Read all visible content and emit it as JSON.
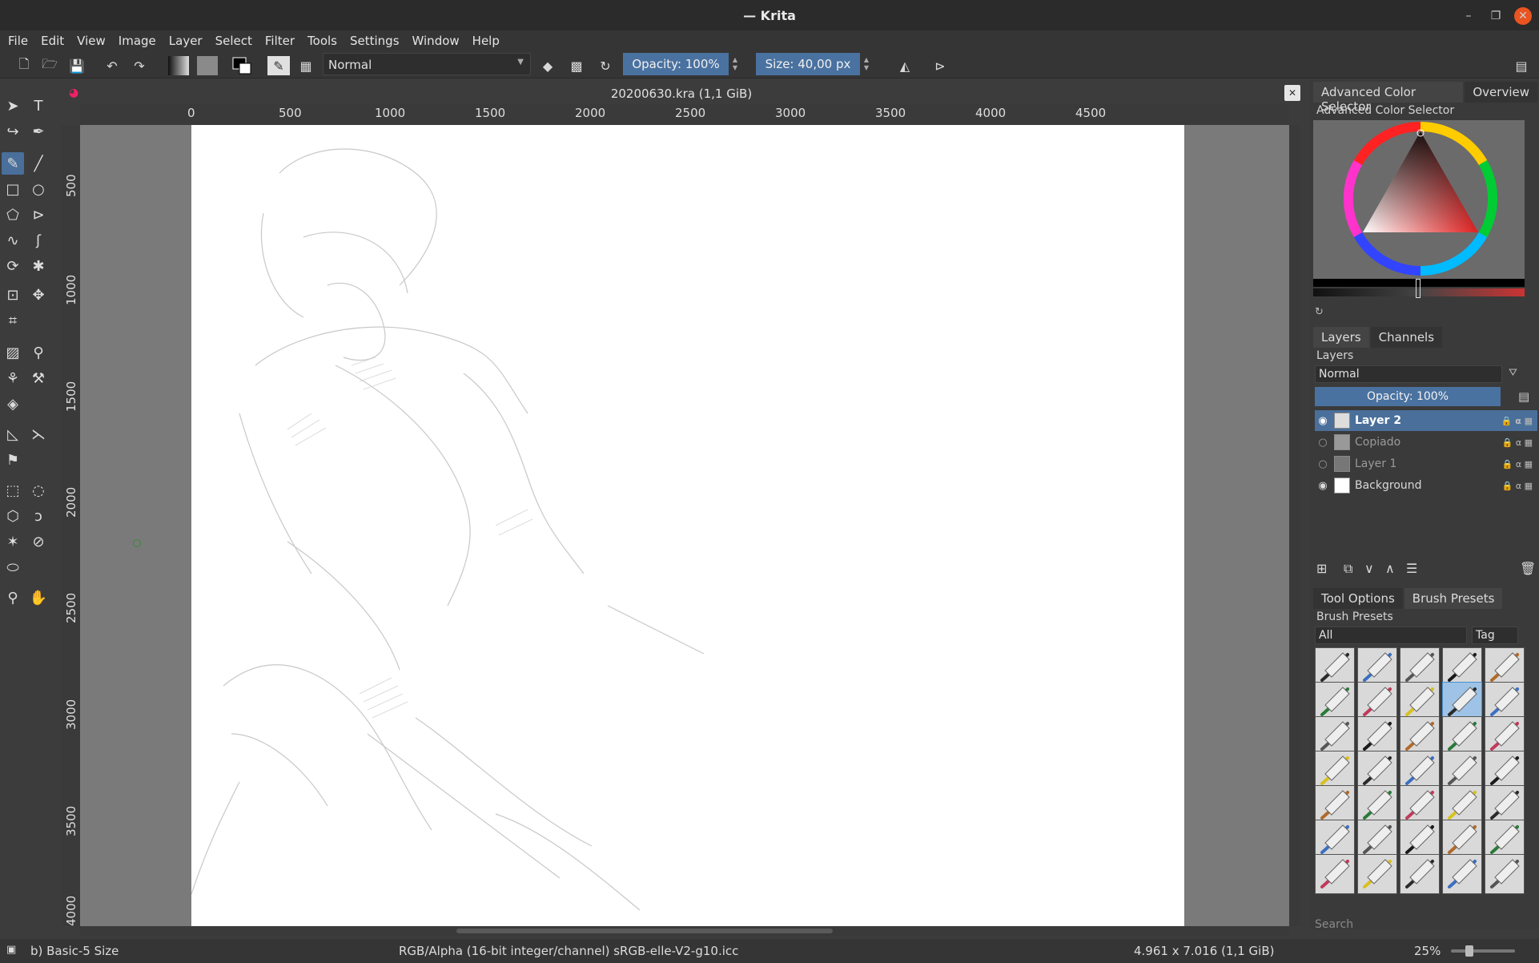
{
  "window": {
    "title": "— Krita"
  },
  "menu": [
    "File",
    "Edit",
    "View",
    "Image",
    "Layer",
    "Select",
    "Filter",
    "Tools",
    "Settings",
    "Window",
    "Help"
  ],
  "toolbar": {
    "blend_mode": "Normal",
    "opacity_label": "Opacity: 100%",
    "size_label": "Size: 40,00 px"
  },
  "document": {
    "title": "20200630.kra (1,1 GiB)",
    "ruler_h": [
      "0",
      "500",
      "1000",
      "1500",
      "2000",
      "2500",
      "3000",
      "3500",
      "4000",
      "4500"
    ],
    "ruler_v": [
      "500",
      "1000",
      "1500",
      "2000",
      "2500",
      "3000",
      "3500",
      "4000"
    ]
  },
  "dock": {
    "color_tabs": [
      "Advanced Color Selector",
      "Overview"
    ],
    "color_panel_title": "Advanced Color Selector",
    "layer_tabs": [
      "Layers",
      "Channels"
    ],
    "layers_title": "Layers",
    "layer_mode": "Normal",
    "layer_opacity": "Opacity:  100%",
    "layers": [
      {
        "name": "Layer 2",
        "visible": true,
        "active": true
      },
      {
        "name": "Copiado",
        "visible": false,
        "active": false
      },
      {
        "name": "Layer 1",
        "visible": false,
        "active": false
      },
      {
        "name": "Background",
        "visible": true,
        "active": false
      }
    ],
    "preset_tabs": [
      "Tool Options",
      "Brush Presets"
    ],
    "presets_title": "Brush Presets",
    "preset_filter": "All",
    "preset_tag": "Tag",
    "search_placeholder": "Search"
  },
  "status": {
    "brush": "b) Basic-5 Size",
    "color_profile": "RGB/Alpha (16-bit integer/channel)  sRGB-elle-V2-g10.icc",
    "dimensions": "4.961 x 7.016 (1,1 GiB)",
    "zoom": "25%"
  },
  "colors": {
    "accent": "#4a72a0",
    "close_button": "#e95420"
  }
}
